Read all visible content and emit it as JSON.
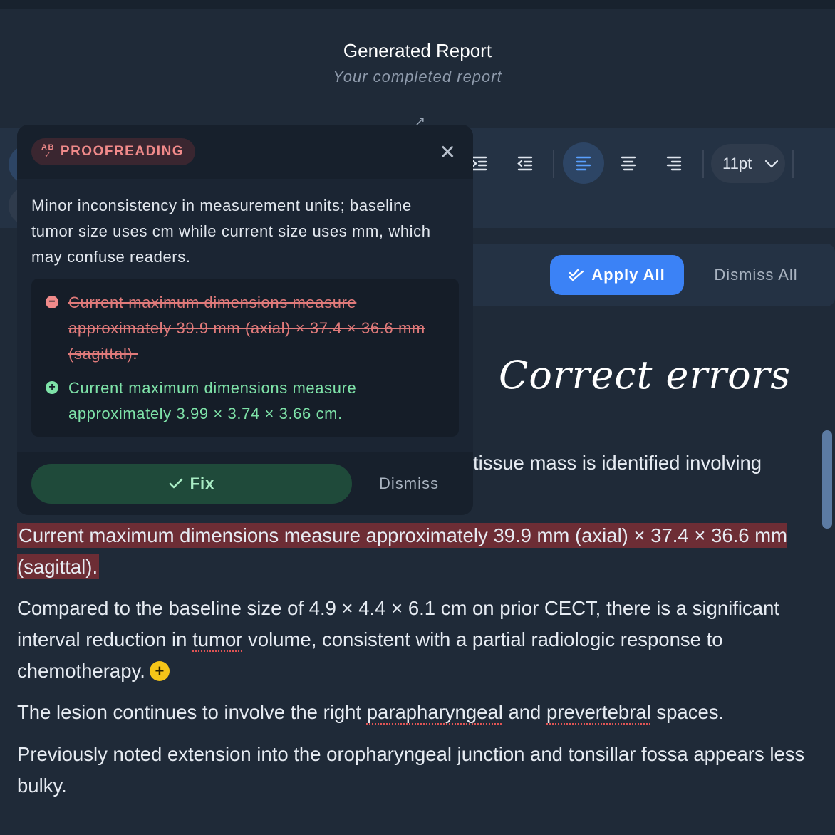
{
  "header": {
    "title": "Generated Report",
    "subtitle": "Your completed report"
  },
  "toolbar": {
    "buttons": [
      "indent-icon",
      "outdent-icon",
      "align-left-icon",
      "align-center-icon",
      "align-right-icon"
    ],
    "active": "align-left-icon",
    "font_size": "11pt"
  },
  "bulk": {
    "apply_all": "Apply All",
    "dismiss_all": "Dismiss All"
  },
  "overlay_caption": "Correct errors",
  "popup": {
    "badge": "PROOFREADING",
    "badge_icon_text": "AB",
    "message": "Minor inconsistency in measurement units; baseline tumor size uses cm while current size uses mm, which may confuse readers.",
    "removed": "Current maximum dimensions measure approximately 39.9 mm (axial) × 37.4 × 36.6 mm (sagittal).",
    "added": "Current maximum dimensions measure approximately 3.99 × 3.74 × 3.66 cm.",
    "fix": "Fix",
    "dismiss": "Dismiss"
  },
  "report": {
    "fragment": "tissue mass is identified involving",
    "highlighted": "Current maximum dimensions measure approximately 39.9 mm (axial) × 37.4 × 36.6 mm (sagittal).",
    "p2_a": "Compared to the baseline size of 4.9 × 4.4 × 6.1 cm on prior CECT, there is a significant interval reduction in ",
    "p2_spell": "tumor",
    "p2_b": " volume, consistent with a partial radiologic response to chemotherapy.",
    "p3_a": "The lesion continues to involve the right ",
    "p3_spell1": "parapharyngeal",
    "p3_b": " and ",
    "p3_spell2": "prevertebral",
    "p3_c": " spaces.",
    "p4": "Previously noted extension into the oropharyngeal junction and tonsillar fossa appears less bulky."
  },
  "colors": {
    "accent": "#3b82f6",
    "highlight": "#6d2d35",
    "removed": "#e07a7a",
    "added": "#7ee2a8",
    "suggestion_dot": "#f5c518"
  }
}
